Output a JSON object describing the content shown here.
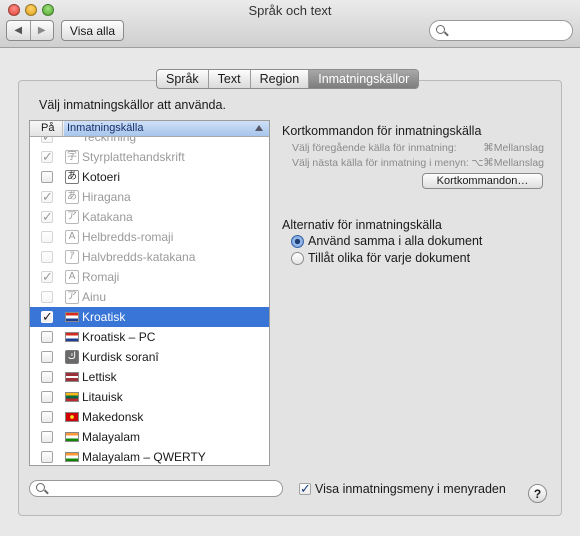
{
  "window": {
    "title": "Språk och text"
  },
  "toolbar": {
    "back": "◀",
    "forward": "▶",
    "show_all": "Visa alla",
    "search_placeholder": ""
  },
  "tabs": [
    {
      "label": "Språk",
      "active": false
    },
    {
      "label": "Text",
      "active": false
    },
    {
      "label": "Region",
      "active": false
    },
    {
      "label": "Inmatningskällor",
      "active": true
    }
  ],
  "prompt": "Välj inmatningskällor att använda.",
  "list": {
    "col_on": "På",
    "col_source": "Inmatningskälla",
    "rows": [
      {
        "label": "Tecknning",
        "icon": "",
        "checked": true,
        "disabled": true,
        "selected": false
      },
      {
        "label": "Styrplattehandskrift",
        "icon": "字",
        "checked": true,
        "disabled": true,
        "selected": false
      },
      {
        "label": "Kotoeri",
        "icon": "あ",
        "checked": false,
        "disabled": false,
        "selected": false
      },
      {
        "label": "Hiragana",
        "icon": "あ",
        "checked": true,
        "disabled": true,
        "selected": false
      },
      {
        "label": "Katakana",
        "icon": "ア",
        "checked": true,
        "disabled": true,
        "selected": false
      },
      {
        "label": "Helbredds-romaji",
        "icon": "A",
        "checked": false,
        "disabled": true,
        "selected": false
      },
      {
        "label": "Halvbredds-katakana",
        "icon": "ｱ",
        "checked": false,
        "disabled": true,
        "selected": false
      },
      {
        "label": "Romaji",
        "icon": "A",
        "checked": true,
        "disabled": true,
        "selected": false
      },
      {
        "label": "Ainu",
        "icon": "ア",
        "checked": false,
        "disabled": true,
        "selected": false
      },
      {
        "label": "Kroatisk",
        "icon": "hr-flag",
        "checked": true,
        "disabled": false,
        "selected": true
      },
      {
        "label": "Kroatisk – PC",
        "icon": "hr-pc-flag",
        "checked": false,
        "disabled": false,
        "selected": false
      },
      {
        "label": "Kurdisk soranî",
        "icon": "ك",
        "checked": false,
        "disabled": false,
        "selected": false
      },
      {
        "label": "Lettisk",
        "icon": "lv-flag",
        "checked": false,
        "disabled": false,
        "selected": false
      },
      {
        "label": "Litauisk",
        "icon": "lt-flag",
        "checked": false,
        "disabled": false,
        "selected": false
      },
      {
        "label": "Makedonsk",
        "icon": "mk-flag",
        "checked": false,
        "disabled": false,
        "selected": false
      },
      {
        "label": "Malayalam",
        "icon": "in-flag",
        "checked": false,
        "disabled": false,
        "selected": false
      },
      {
        "label": "Malayalam – QWERTY",
        "icon": "in-flag",
        "checked": false,
        "disabled": false,
        "selected": false
      }
    ]
  },
  "shortcuts": {
    "title": "Kortkommandon för inmatningskälla",
    "prev_label": "Välj föregående källa för inmatning:",
    "prev_key": "⌘Mellanslag",
    "next_label": "Välj nästa källa för inmatning i menyn:",
    "next_key": "⌥⌘Mellanslag",
    "button": "Kortkommandon…"
  },
  "options": {
    "title": "Alternativ för inmatningskälla",
    "same": "Använd samma i alla dokument",
    "different": "Tillåt olika för varje dokument",
    "selected": "same"
  },
  "footer": {
    "search_placeholder": "",
    "show_menu_label": "Visa inmatningsmeny i menyraden",
    "show_menu_checked": true,
    "help": "?"
  }
}
